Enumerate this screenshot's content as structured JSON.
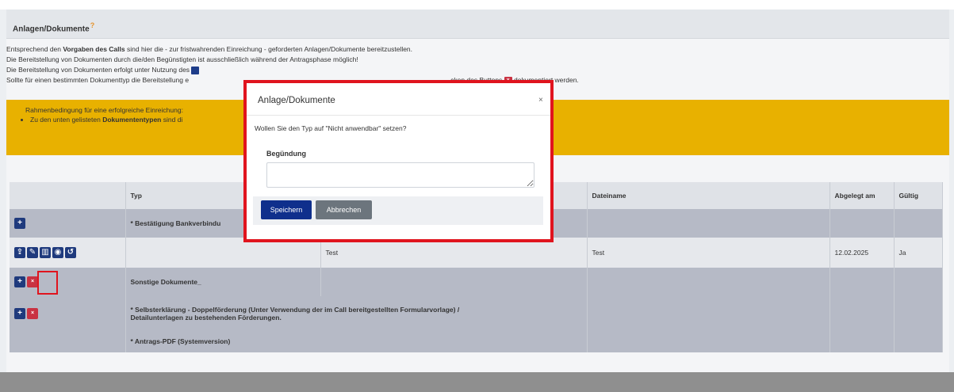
{
  "panel": {
    "title": "Anlagen/Dokumente",
    "help_icon": "?",
    "intro": {
      "line1_before": "Entsprechend den ",
      "line1_bold": "Vorgaben des Calls",
      "line1_after": " sind hier die - zur fristwahrenden Einreichung - geforderten Anlagen/Dokumente bereitzustellen.",
      "line2": "Die Bereitstellung von Dokumenten durch die/den Begünstigten ist ausschließlich während der Antragsphase möglich!",
      "line3": "Die Bereitstellung von Dokumenten erfolgt unter Nutzung des",
      "line4_start": "Sollte für einen bestimmten Dokumenttyp die Bereitstellung e",
      "line4_end": "cken des Buttons",
      "line4_tail": " dokumentiert werden."
    },
    "note": {
      "title": "Rahmenbedingung für eine erfolgreiche Einreichung:",
      "bullet_before": "Zu den unten gelisteten ",
      "bullet_bold": "Dokumententypen",
      "bullet_after": " sind di"
    }
  },
  "table": {
    "headers": {
      "typ": "Typ",
      "dateiname": "Dateiname",
      "abgelegt": "Abgelegt am",
      "gueltig": "Gültig"
    },
    "rows": {
      "bank": "* Bestätigung Bankverbindu",
      "file_desc": "Test",
      "file_name": "Test",
      "file_date": "12.02.2025",
      "file_valid": "Ja",
      "sonstige": "Sonstige Dokumente_",
      "selbst_line1": "* Selbsterklärung - Doppelförderung (Unter Verwendung der im Call bereitgestellten Formularvorlage) /",
      "selbst_line2": "Detailunterlagen zu bestehenden Förderungen.",
      "antrag": "* Antrags-PDF (Systemversion)"
    }
  },
  "modal": {
    "title": "Anlage/Dokumente",
    "close": "×",
    "question": "Wollen Sie den Typ auf \"Nicht anwendbar\" setzen?",
    "label": "Begündung",
    "textarea_value": "",
    "save": "Speichern",
    "cancel": "Abbrechen"
  },
  "icons": {
    "plus": "+",
    "delete": "×",
    "upload": "⇪",
    "edit": "✎",
    "trash": "▥",
    "view": "◉",
    "history": "↺"
  },
  "colors": {
    "primary": "#1f3a7d",
    "danger": "#c93242",
    "warning": "#e8b100",
    "highlight": "#e0141e"
  }
}
